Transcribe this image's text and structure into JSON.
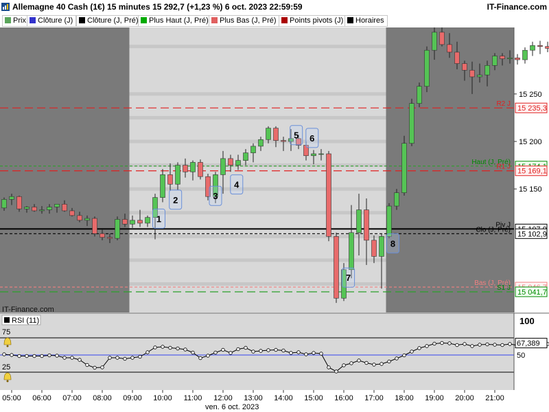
{
  "header": {
    "title": "Allemagne 40 Cash (1€) 15 minutes 15 292,7 (+1,23 %) 6 oct. 2023 22:59:59",
    "brand": "IT-Finance.com"
  },
  "legend": [
    {
      "label": "Prix",
      "color": "#5aa55a"
    },
    {
      "label": "Clôture (J)",
      "color": "#3333cc"
    },
    {
      "label": "Clôture (J, Pré)",
      "color": "#000000"
    },
    {
      "label": "Plus Haut (J, Pré)",
      "color": "#00aa00"
    },
    {
      "label": "Plus Bas (J, Pré)",
      "color": "#e06060"
    },
    {
      "label": "Points pivots (J)",
      "color": "#aa0000"
    },
    {
      "label": "Horaires",
      "color": "#000000"
    }
  ],
  "watermark": "IT-Finance.com",
  "date_label": "ven. 6 oct. 2023",
  "rsi": {
    "label": "RSI (11)",
    "level_high": "75",
    "level_low": "25",
    "scale_top": "100",
    "scale_mid": "50",
    "current_value_text": "67,389",
    "values": [
      51.0,
      50.0,
      48.5,
      48.5,
      48.5,
      48.5,
      49.5,
      49.0,
      46.0,
      46.0,
      43.0,
      35.5,
      31.5,
      32.0,
      46.0,
      46.0,
      44.5,
      46.0,
      47.5,
      54.0,
      61.0,
      62.0,
      60.5,
      59.5,
      58.0,
      53.5,
      45.5,
      49.0,
      53.5,
      57.5,
      53.0,
      58.5,
      60.5,
      55.0,
      56.0,
      57.0,
      57.5,
      56.5,
      53.0,
      54.0,
      51.0,
      53.0,
      52.0,
      32.0,
      26.0,
      35.0,
      38.0,
      42.0,
      38.5,
      36.0,
      37.0,
      40.5,
      45.0,
      49.5,
      55.0,
      60.0,
      63.0,
      66.5,
      67.5,
      67.0,
      64.5,
      66.0,
      63.0,
      65.0,
      65.5,
      65.0,
      64.5,
      66.0,
      64.0,
      66.5,
      66.5,
      65.0,
      66.0,
      65.5,
      65.5,
      67.4
    ]
  },
  "chart_data": {
    "type": "candlestick",
    "title": "Allemagne 40 Cash (1€) 15 minutes",
    "instrument": "Allemagne 40 Cash (1€)",
    "timeframe": "15 minutes",
    "last_price": "15 292,7",
    "change": "+1,23 %",
    "datetime": "6 oct. 2023 22:59:59",
    "y_ticks": [
      "15 250",
      "15 200",
      "15 150"
    ],
    "y_tick_values": [
      15250,
      15200,
      15150
    ],
    "ylim": [
      15020,
      15320
    ],
    "x_ticks": [
      "05:00",
      "06:00",
      "07:00",
      "08:00",
      "09:00",
      "10:00",
      "11:00",
      "12:00",
      "13:00",
      "14:00",
      "15:00",
      "16:00",
      "17:00",
      "18:00",
      "19:00",
      "20:00",
      "21:00"
    ],
    "x_first_hour": 5,
    "candles_per_hour": 4,
    "first_candle_time": "04:45",
    "session_hours": {
      "start": "09:00",
      "end": "17:30"
    },
    "grid": "horizontal bands",
    "candles": [
      {
        "o": 15130,
        "h": 15141,
        "l": 15127,
        "c": 15139
      },
      {
        "o": 15139,
        "h": 15145,
        "l": 15133,
        "c": 15142
      },
      {
        "o": 15142,
        "h": 15143,
        "l": 15126,
        "c": 15129
      },
      {
        "o": 15129,
        "h": 15132,
        "l": 15125,
        "c": 15131
      },
      {
        "o": 15131,
        "h": 15134,
        "l": 15126,
        "c": 15127
      },
      {
        "o": 15127,
        "h": 15132,
        "l": 15124,
        "c": 15128
      },
      {
        "o": 15128,
        "h": 15134,
        "l": 15124,
        "c": 15131
      },
      {
        "o": 15131,
        "h": 15134,
        "l": 15125,
        "c": 15134
      },
      {
        "o": 15134,
        "h": 15138,
        "l": 15126,
        "c": 15127
      },
      {
        "o": 15127,
        "h": 15130,
        "l": 15121,
        "c": 15122
      },
      {
        "o": 15122,
        "h": 15126,
        "l": 15115,
        "c": 15117
      },
      {
        "o": 15117,
        "h": 15122,
        "l": 15111,
        "c": 15119
      },
      {
        "o": 15119,
        "h": 15121,
        "l": 15100,
        "c": 15103
      },
      {
        "o": 15103,
        "h": 15107,
        "l": 15096,
        "c": 15099
      },
      {
        "o": 15099,
        "h": 15103,
        "l": 15093,
        "c": 15098
      },
      {
        "o": 15098,
        "h": 15121,
        "l": 15096,
        "c": 15118
      },
      {
        "o": 15118,
        "h": 15124,
        "l": 15110,
        "c": 15113
      },
      {
        "o": 15113,
        "h": 15122,
        "l": 15109,
        "c": 15117
      },
      {
        "o": 15117,
        "h": 15128,
        "l": 15110,
        "c": 15114
      },
      {
        "o": 15114,
        "h": 15122,
        "l": 15110,
        "c": 15120
      },
      {
        "o": 15120,
        "h": 15145,
        "l": 15097,
        "c": 15141
      },
      {
        "o": 15141,
        "h": 15171,
        "l": 15136,
        "c": 15165
      },
      {
        "o": 15165,
        "h": 15177,
        "l": 15148,
        "c": 15155
      },
      {
        "o": 15155,
        "h": 15178,
        "l": 15149,
        "c": 15175
      },
      {
        "o": 15175,
        "h": 15182,
        "l": 15162,
        "c": 15168
      },
      {
        "o": 15168,
        "h": 15180,
        "l": 15159,
        "c": 15178
      },
      {
        "o": 15178,
        "h": 15181,
        "l": 15160,
        "c": 15163
      },
      {
        "o": 15163,
        "h": 15166,
        "l": 15138,
        "c": 15142
      },
      {
        "o": 15142,
        "h": 15168,
        "l": 15135,
        "c": 15165
      },
      {
        "o": 15165,
        "h": 15190,
        "l": 15145,
        "c": 15182
      },
      {
        "o": 15182,
        "h": 15186,
        "l": 15168,
        "c": 15175
      },
      {
        "o": 15175,
        "h": 15186,
        "l": 15170,
        "c": 15180
      },
      {
        "o": 15180,
        "h": 15192,
        "l": 15175,
        "c": 15188
      },
      {
        "o": 15188,
        "h": 15198,
        "l": 15178,
        "c": 15195
      },
      {
        "o": 15195,
        "h": 15205,
        "l": 15190,
        "c": 15202
      },
      {
        "o": 15202,
        "h": 15216,
        "l": 15198,
        "c": 15214
      },
      {
        "o": 15214,
        "h": 15216,
        "l": 15194,
        "c": 15201
      },
      {
        "o": 15201,
        "h": 15205,
        "l": 15190,
        "c": 15200
      },
      {
        "o": 15200,
        "h": 15213,
        "l": 15190,
        "c": 15203
      },
      {
        "o": 15203,
        "h": 15207,
        "l": 15192,
        "c": 15196
      },
      {
        "o": 15196,
        "h": 15200,
        "l": 15180,
        "c": 15185
      },
      {
        "o": 15185,
        "h": 15191,
        "l": 15176,
        "c": 15187
      },
      {
        "o": 15187,
        "h": 15192,
        "l": 15180,
        "c": 15187
      },
      {
        "o": 15187,
        "h": 15190,
        "l": 15095,
        "c": 15100
      },
      {
        "o": 15100,
        "h": 15104,
        "l": 15030,
        "c": 15035
      },
      {
        "o": 15035,
        "h": 15072,
        "l": 15032,
        "c": 15065
      },
      {
        "o": 15065,
        "h": 15133,
        "l": 15056,
        "c": 15104
      },
      {
        "o": 15104,
        "h": 15145,
        "l": 15080,
        "c": 15128
      },
      {
        "o": 15128,
        "h": 15140,
        "l": 15070,
        "c": 15096
      },
      {
        "o": 15096,
        "h": 15101,
        "l": 15072,
        "c": 15079
      },
      {
        "o": 15079,
        "h": 15103,
        "l": 15045,
        "c": 15100
      },
      {
        "o": 15100,
        "h": 15135,
        "l": 15098,
        "c": 15132
      },
      {
        "o": 15132,
        "h": 15150,
        "l": 15128,
        "c": 15146
      },
      {
        "o": 15146,
        "h": 15206,
        "l": 15143,
        "c": 15198
      },
      {
        "o": 15198,
        "h": 15245,
        "l": 15195,
        "c": 15240
      },
      {
        "o": 15240,
        "h": 15262,
        "l": 15236,
        "c": 15258
      },
      {
        "o": 15258,
        "h": 15300,
        "l": 15252,
        "c": 15296
      },
      {
        "o": 15296,
        "h": 15320,
        "l": 15286,
        "c": 15315
      },
      {
        "o": 15315,
        "h": 15320,
        "l": 15300,
        "c": 15302
      },
      {
        "o": 15302,
        "h": 15314,
        "l": 15288,
        "c": 15294
      },
      {
        "o": 15294,
        "h": 15305,
        "l": 15276,
        "c": 15282
      },
      {
        "o": 15282,
        "h": 15285,
        "l": 15264,
        "c": 15275
      },
      {
        "o": 15275,
        "h": 15284,
        "l": 15250,
        "c": 15268
      },
      {
        "o": 15268,
        "h": 15282,
        "l": 15262,
        "c": 15270
      },
      {
        "o": 15270,
        "h": 15285,
        "l": 15258,
        "c": 15280
      },
      {
        "o": 15280,
        "h": 15293,
        "l": 15275,
        "c": 15290
      },
      {
        "o": 15290,
        "h": 15293,
        "l": 15280,
        "c": 15287
      },
      {
        "o": 15287,
        "h": 15296,
        "l": 15282,
        "c": 15288
      },
      {
        "o": 15288,
        "h": 15292,
        "l": 15281,
        "c": 15286
      },
      {
        "o": 15286,
        "h": 15299,
        "l": 15282,
        "c": 15296
      },
      {
        "o": 15296,
        "h": 15305,
        "l": 15290,
        "c": 15301
      },
      {
        "o": 15301,
        "h": 15306,
        "l": 15292,
        "c": 15300
      },
      {
        "o": 15300,
        "h": 15305,
        "l": 15294,
        "c": 15298
      },
      {
        "o": 15298,
        "h": 15304,
        "l": 15292,
        "c": 15296
      },
      {
        "o": 15296,
        "h": 15303,
        "l": 15291,
        "c": 15299
      },
      {
        "o": 15299,
        "h": 15303,
        "l": 15288,
        "c": 15293
      }
    ],
    "levels": [
      {
        "name": "R2 J",
        "value": 15235.3,
        "label": "15 235,3",
        "color": "#e02020",
        "style": "dash-long",
        "tag_color": "#e02020",
        "tag_bg": "#fff0f0"
      },
      {
        "name": "Haut (J, Pré)",
        "value": 15174.1,
        "label": "15 174,1",
        "color": "#2aa02a",
        "style": "dash-short",
        "tag_color": "#008800",
        "tag_bg": "#f0fff0"
      },
      {
        "name": "R1 J",
        "value": 15169.1,
        "label": "15 169,1",
        "color": "#e02020",
        "style": "dash-long",
        "tag_color": "#e02020",
        "tag_bg": "#fff0f0"
      },
      {
        "name": "Piv J",
        "value": 15107.9,
        "label": "15 107,9",
        "color": "#000000",
        "style": "solid",
        "tag_color": "#000000",
        "tag_bg": "#ffffff"
      },
      {
        "name": "Clo (J, Pré)",
        "value": 15102.9,
        "label": "15 102,9",
        "color": "#000000",
        "style": "dash-short",
        "tag_color": "#000000",
        "tag_bg": "#ffffff"
      },
      {
        "name": "Bas (J, Pré)",
        "value": 15046.7,
        "label": "15 046,7",
        "color": "#f08080",
        "style": "dash-short",
        "tag_color": "#f08080",
        "tag_bg": "#fff5f5"
      },
      {
        "name": "S1 J",
        "value": 15041.7,
        "label": "15 041,7",
        "color": "#2aa02a",
        "style": "dash-long",
        "tag_color": "#008800",
        "tag_bg": "#f0fff0"
      }
    ],
    "annotations": [
      {
        "text": "1",
        "candle": 20.5,
        "price": 15118
      },
      {
        "text": "2",
        "candle": 22.7,
        "price": 15138
      },
      {
        "text": "3",
        "candle": 28.0,
        "price": 15142
      },
      {
        "text": "4",
        "candle": 30.8,
        "price": 15154
      },
      {
        "text": "5",
        "candle": 38.7,
        "price": 15206
      },
      {
        "text": "6",
        "candle": 40.8,
        "price": 15203
      },
      {
        "text": "7",
        "candle": 45.6,
        "price": 15056
      },
      {
        "text": "8",
        "candle": 51.5,
        "price": 15092
      }
    ]
  },
  "colors": {
    "up": "#55c455",
    "down": "#e86b6b",
    "session_bg": "#d8d8d8",
    "off_session_bg": "#7a7a7a",
    "band": "#c0c0c0",
    "rsi_line": "#000000",
    "rsi_mid_line": "#3344ee"
  }
}
